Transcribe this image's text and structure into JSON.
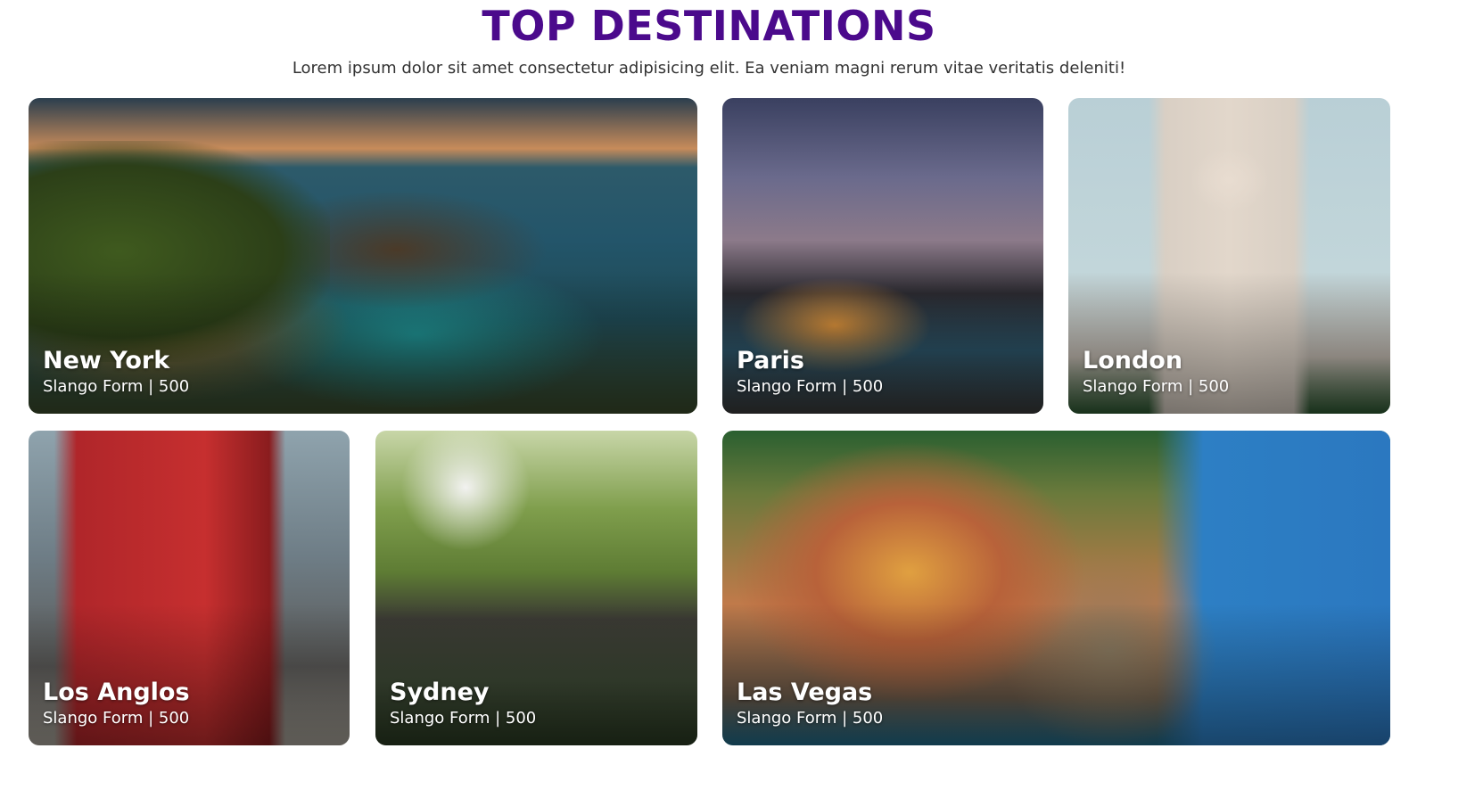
{
  "header": {
    "title": "TOP DESTINATIONS",
    "subtitle": "Lorem ipsum dolor sit amet consectetur adipisicing elit. Ea veniam magni rerum vitae veritatis deleniti!"
  },
  "colors": {
    "title": "#4b0a8c",
    "subtitle": "#333333",
    "card_text": "#ffffff"
  },
  "destinations": [
    {
      "name": "New York",
      "meta": "Slango Form | 500",
      "image": "coastal-cliff-sunset-photo"
    },
    {
      "name": "Paris",
      "meta": "Slango Form | 500",
      "image": "tropical-resort-pool-photo"
    },
    {
      "name": "London",
      "meta": "Slango Form | 500",
      "image": "taj-mahal-photo"
    },
    {
      "name": "Los Anglos",
      "meta": "Slango Form | 500",
      "image": "red-tram-photo"
    },
    {
      "name": "Sydney",
      "meta": "Slango Form | 500",
      "image": "steam-train-viaduct-photo"
    },
    {
      "name": "Las Vegas",
      "meta": "Slango Form | 500",
      "image": "colorful-cliff-village-photo"
    }
  ]
}
